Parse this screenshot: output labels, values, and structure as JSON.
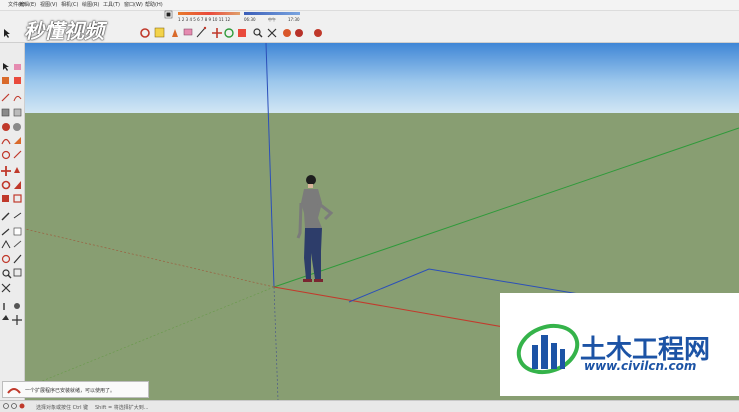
{
  "menu": {
    "items": [
      "文件(F)",
      "编辑(E)",
      "视图(V)",
      "相机(C)",
      "绘图(R)",
      "工具(T)",
      "窗口(W)",
      "帮助(H)"
    ]
  },
  "shadow": {
    "months": "1 2 3 4 5 6 7 8 9 10 11 12",
    "time_start": "06:30",
    "time_mid": "中午",
    "time_end": "17:30"
  },
  "notice": {
    "text": "一个扩展程序已安装就绪，可以使用了。"
  },
  "status": {
    "hint_left": "选择对象或按住 Ctrl 键",
    "hint_right": "Shift = 将选择扩大到..."
  },
  "watermark_top": {
    "text": "秒懂视频"
  },
  "watermark_bottom": {
    "title": "土木工程网",
    "url": "www.civilcn.com"
  },
  "colors": {
    "sky_top": "#3f86d6",
    "sky_bottom": "#d2e6f4",
    "ground": "#889e72",
    "axis_red": "#c23a2c",
    "axis_green": "#2f9a3a",
    "axis_blue": "#2b4fb9",
    "brand_blue": "#1c53a5",
    "brand_green": "#35b34a"
  }
}
